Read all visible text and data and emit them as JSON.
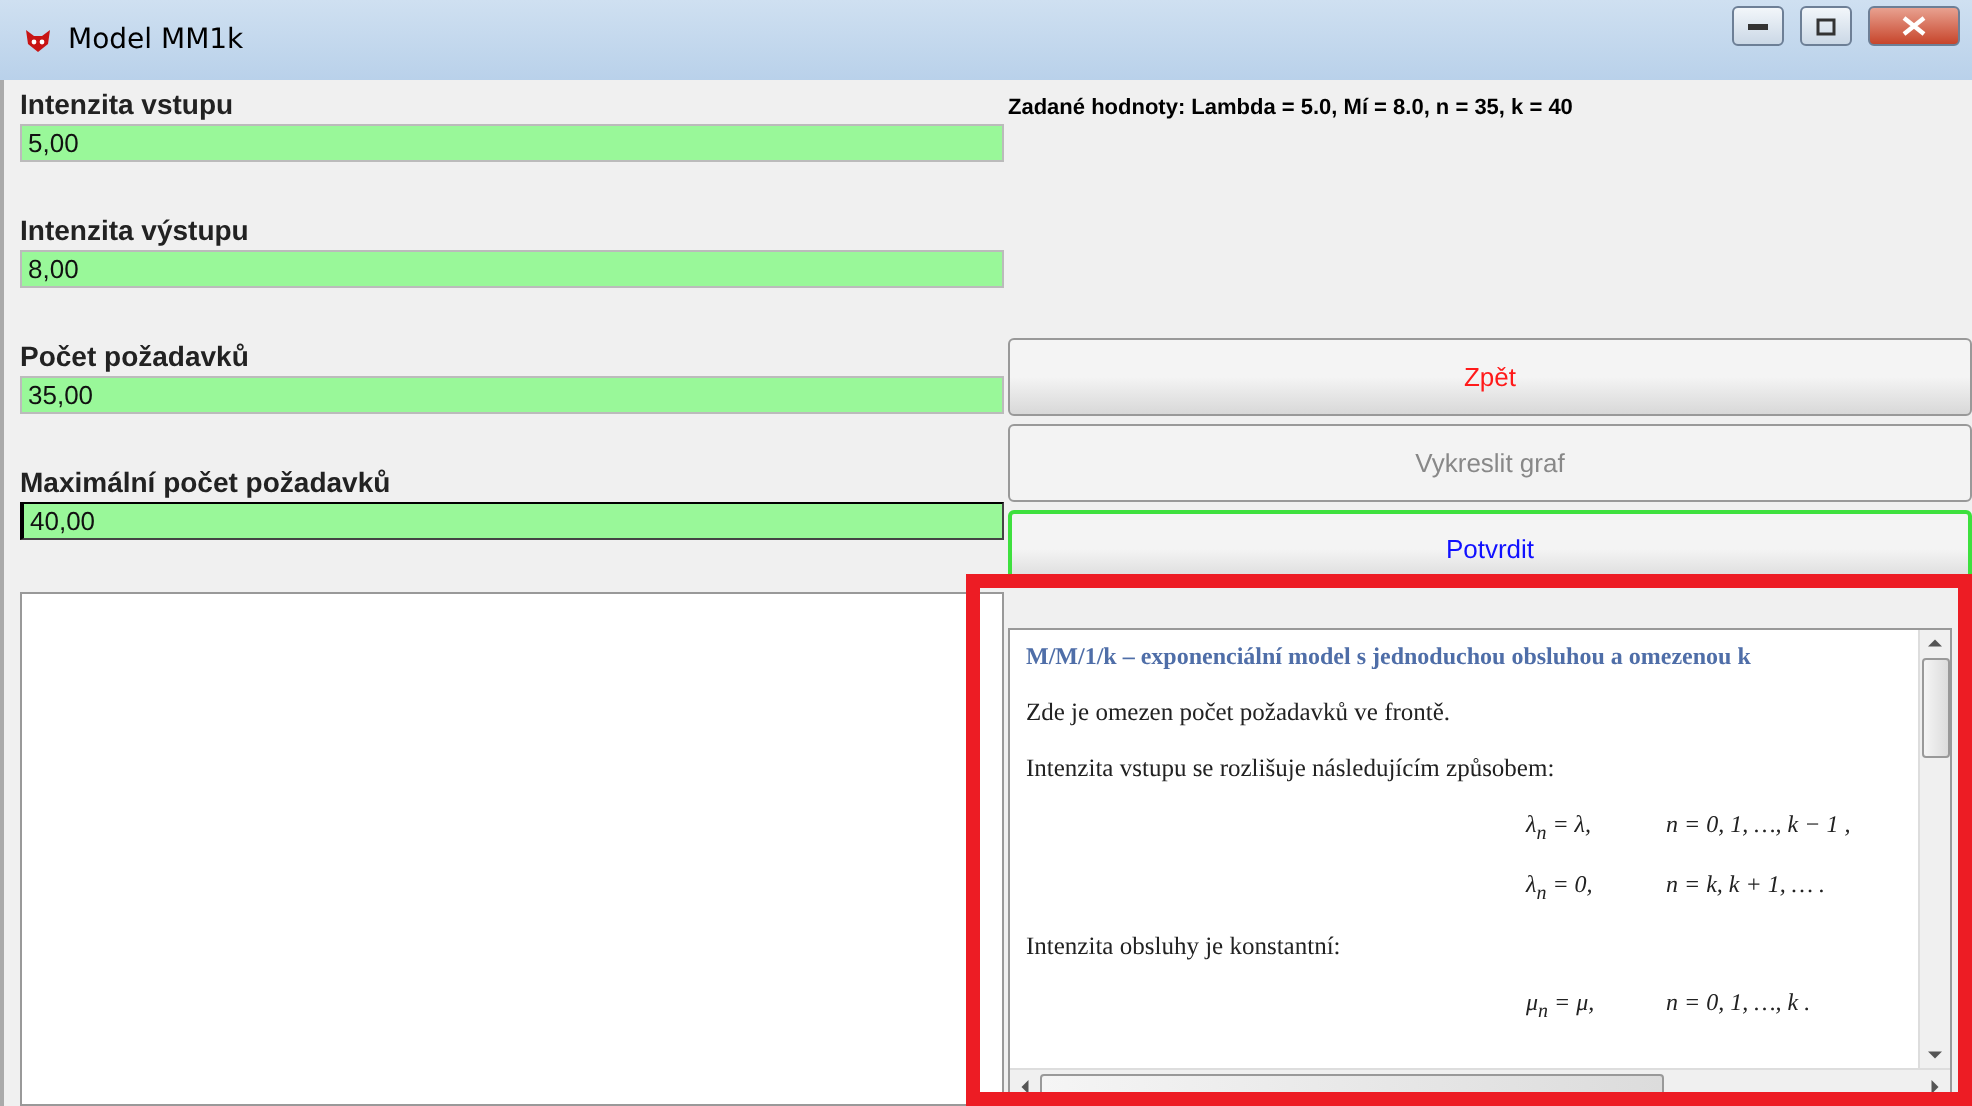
{
  "window": {
    "title": "Model MM1k"
  },
  "fields": [
    {
      "label": "Intenzita vstupu",
      "value": "5,00",
      "focused": false
    },
    {
      "label": "Intenzita výstupu",
      "value": "8,00",
      "focused": false
    },
    {
      "label": "Počet požadavků",
      "value": "35,00",
      "focused": false
    },
    {
      "label": "Maximální počet požadavků",
      "value": "40,00",
      "focused": true
    }
  ],
  "summary": "Zadané hodnoty: Lambda = 5.0, Mí = 8.0, n = 35, k = 40",
  "buttons": [
    {
      "label": "Zpět",
      "kind": "danger",
      "disabled": false,
      "focused": false
    },
    {
      "label": "Vykreslit graf",
      "kind": "normal",
      "disabled": true,
      "focused": false
    },
    {
      "label": "Potvrdit",
      "kind": "primary",
      "disabled": false,
      "focused": true
    }
  ],
  "help": {
    "heading": "M/M/1/k – exponenciální model s jednoduchou obsluhou a omezenou k",
    "blocks": [
      {
        "kind": "text",
        "text": "Zde je omezen počet požadavků ve frontě."
      },
      {
        "kind": "text",
        "text": "Intenzita vstupu se rozlišuje následujícím způsobem:"
      },
      {
        "kind": "formula",
        "left": "λ$_{n}$ = λ,",
        "right": "n = 0, 1, …, k − 1  ,"
      },
      {
        "kind": "formula",
        "left": "λ$_{n}$ = 0,",
        "right": "n = k, k + 1, …  ."
      },
      {
        "kind": "text",
        "text": "Intenzita obsluhy je konstantní:"
      },
      {
        "kind": "formula",
        "left": "μ$_{n}$ = μ,",
        "right": "n = 0, 1, …, k  ."
      }
    ]
  }
}
